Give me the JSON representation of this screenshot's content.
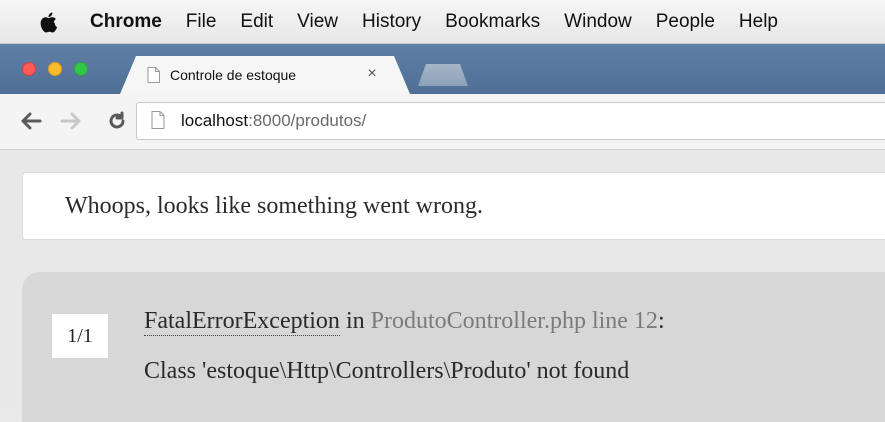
{
  "menubar": {
    "apple_icon": "apple-logo-icon",
    "app_name": "Chrome",
    "items": [
      "File",
      "Edit",
      "View",
      "History",
      "Bookmarks",
      "Window",
      "People",
      "Help"
    ]
  },
  "window": {
    "traffic_lights": {
      "close_color": "#fc5b57",
      "minimize_color": "#fdbc2e",
      "zoom_color": "#33c748"
    }
  },
  "tab": {
    "title": "Controle de estoque",
    "favicon": "page-icon",
    "close_glyph": "×"
  },
  "toolbar": {
    "back_icon": "arrow-left-icon",
    "forward_icon": "arrow-right-icon",
    "reload_icon": "reload-icon",
    "url_host": "localhost",
    "url_rest": ":8000/produtos/"
  },
  "page": {
    "title": "Whoops, looks like something went wrong.",
    "error": {
      "count": "1/1",
      "exception": "FatalErrorException",
      "in_text": " in ",
      "file_line": "ProdutoController.php line 12",
      "colon": ":",
      "message": "Class 'estoque\\Http\\Controllers\\Produto' not found"
    }
  },
  "colors": {
    "tabstrip": "#5a7aa1",
    "page_background": "#e8e8e8",
    "error_panel": "#d7d7d7",
    "file_text": "#7b7b7b"
  }
}
